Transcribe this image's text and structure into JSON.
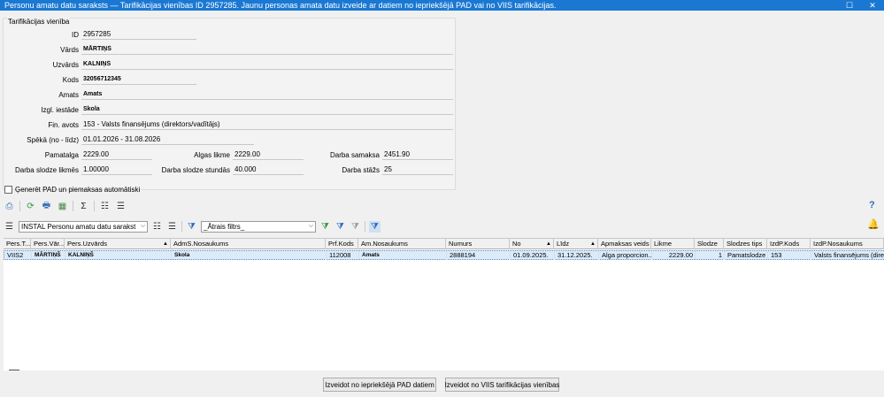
{
  "window": {
    "title": "Personu amatu datu saraksts — Tarifikācijas vienības ID 2957285. Jaunu personas amata datu izveide ar datiem no iepriekšējā PAD vai no VIIS tarifikācijas.",
    "maximize_icon": "maximize-icon",
    "close_icon": "close-icon"
  },
  "group": {
    "title": "Tarifikācijas vienība",
    "fields": {
      "id": {
        "label": "ID",
        "value": "2957285"
      },
      "vards": {
        "label": "Vārds",
        "value": "MĀRTIŅŠ"
      },
      "uzvards": {
        "label": "Uzvārds",
        "value": "KALNIŅŠ"
      },
      "kods": {
        "label": "Kods",
        "value": "32056712345"
      },
      "amats": {
        "label": "Amats",
        "value": "Amats"
      },
      "iestade": {
        "label": "Izgl. iestāde",
        "value": "Skola"
      },
      "fin_avots": {
        "label": "Fin. avots",
        "value": "153 - Valsts finansējums (direktors/vadītājs)"
      },
      "speka": {
        "label": "Spēkā (no - līdz)",
        "value": "01.01.2026 - 31.08.2026"
      },
      "pamatalga": {
        "label": "Pamatalga",
        "value": "2229.00"
      },
      "algas_likme": {
        "label": "Algas likme",
        "value": "2229.00"
      },
      "darba_samaksa": {
        "label": "Darba samaksa",
        "value": "2451.90"
      },
      "slodze_likmes": {
        "label": "Darba slodze likmēs",
        "value": "1.00000"
      },
      "slodze_stundas": {
        "label": "Darba slodze stundās",
        "value": "40.000"
      },
      "darba_stazs": {
        "label": "Darba stāžs",
        "value": "25"
      }
    }
  },
  "auto_checkbox": {
    "label": "Ģenerēt PAD un piemaksas automātiski",
    "checked": false
  },
  "toolbar": {
    "layout_combo": "INSTAL Personu amatu datu sarakst",
    "quick_filter": "_Ātrais filtrs_"
  },
  "grid": {
    "columns": [
      "Pers.T...",
      "Pers.Vār...",
      "Pers.Uzvārds",
      "AdmS.Nosaukums",
      "Prf.Kods",
      "Am.Nosaukums",
      "Numurs",
      "No",
      "Līdz",
      "Apmaksas veids",
      "Likme",
      "Slodze",
      "Slodzes tips",
      "IzdP.Kods",
      "IzdP.Nosaukums"
    ],
    "rows": [
      [
        "VIIS2",
        "MĀRTIŅŠ",
        "KALNIŅŠ",
        "Skola",
        "112008",
        "Amats",
        "2888194",
        "01.09.2025.",
        "31.12.2025.",
        "Alga proporcion...",
        "2229.00",
        "1",
        "Pamatslodze",
        "153",
        "Valsts finansējums (direk"
      ]
    ]
  },
  "buttons": {
    "from_pad": "Izveidot no iepriekšējā PAD datiem",
    "from_viis": "Izveidot no VIIS tarifikācijas vienības"
  },
  "colors": {
    "titlebar": "#1a78d3",
    "selected_row": "#dcebf8"
  }
}
